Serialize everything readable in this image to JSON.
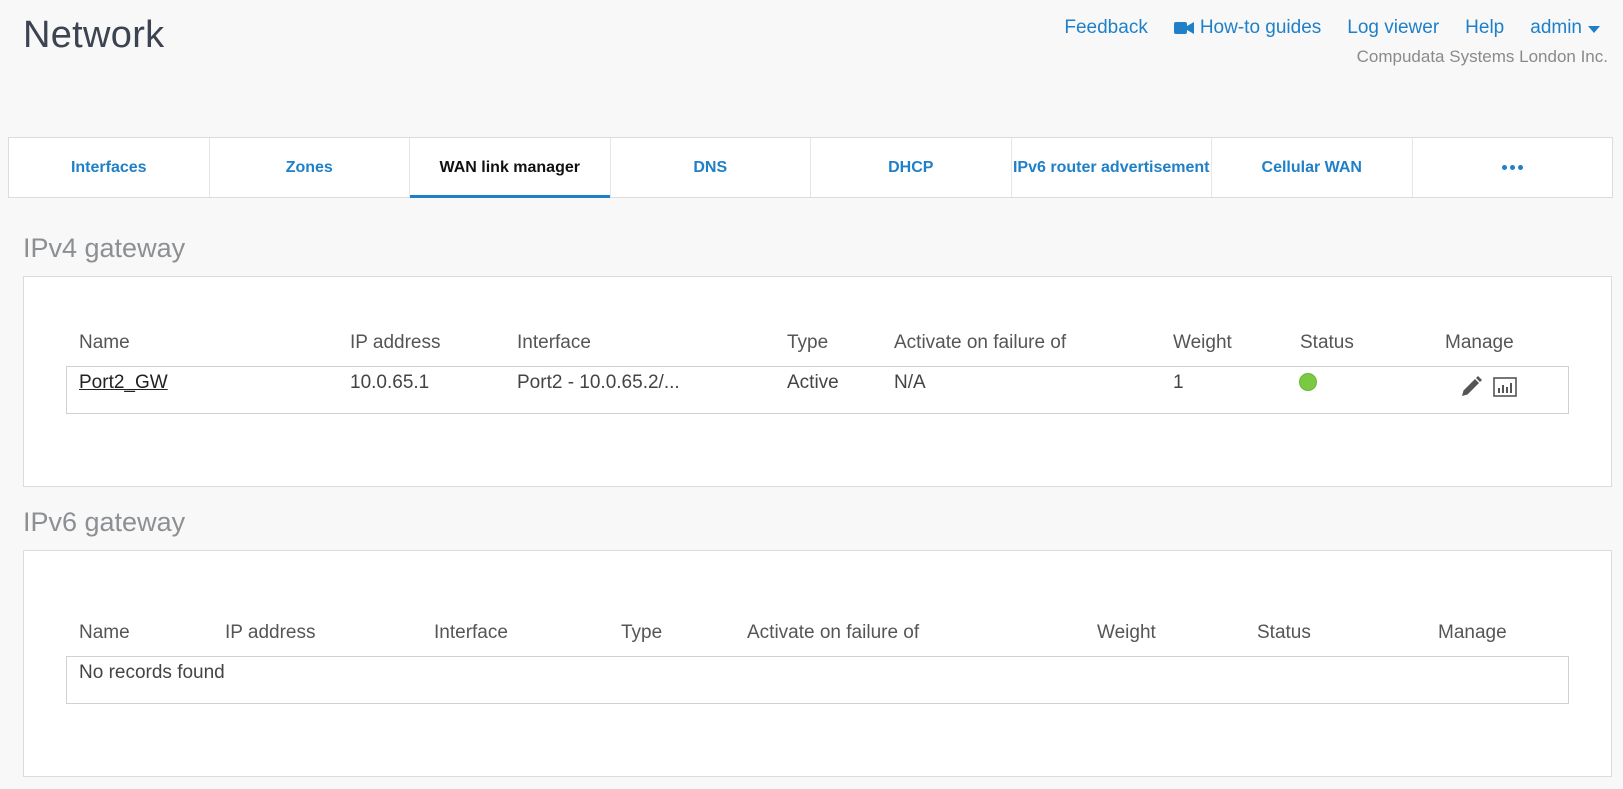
{
  "page": {
    "title": "Network"
  },
  "top_links": {
    "feedback": "Feedback",
    "howto": "How-to guides",
    "log_viewer": "Log viewer",
    "help": "Help",
    "user": "admin",
    "company": "Compudata Systems London Inc."
  },
  "tabs": [
    {
      "label": "Interfaces",
      "active": false
    },
    {
      "label": "Zones",
      "active": false
    },
    {
      "label": "WAN link manager",
      "active": true
    },
    {
      "label": "DNS",
      "active": false
    },
    {
      "label": "DHCP",
      "active": false
    },
    {
      "label": "IPv6 router advertisement",
      "active": false
    },
    {
      "label": "Cellular WAN",
      "active": false
    }
  ],
  "ipv4": {
    "title": "IPv4 gateway",
    "columns": [
      "Name",
      "IP address",
      "Interface",
      "Type",
      "Activate on failure of",
      "Weight",
      "Status",
      "Manage"
    ],
    "row": {
      "name": "Port2_GW",
      "ip": "10.0.65.1",
      "interface": "Port2 - 10.0.65.2/...",
      "type": "Active",
      "failover": "N/A",
      "weight": "1",
      "status": "up"
    }
  },
  "ipv6": {
    "title": "IPv6 gateway",
    "columns": [
      "Name",
      "IP address",
      "Interface",
      "Type",
      "Activate on failure of",
      "Weight",
      "Status",
      "Manage"
    ],
    "empty_text": "No records found"
  },
  "colors": {
    "accent": "#1f80c8",
    "status_up": "#7ac943"
  }
}
